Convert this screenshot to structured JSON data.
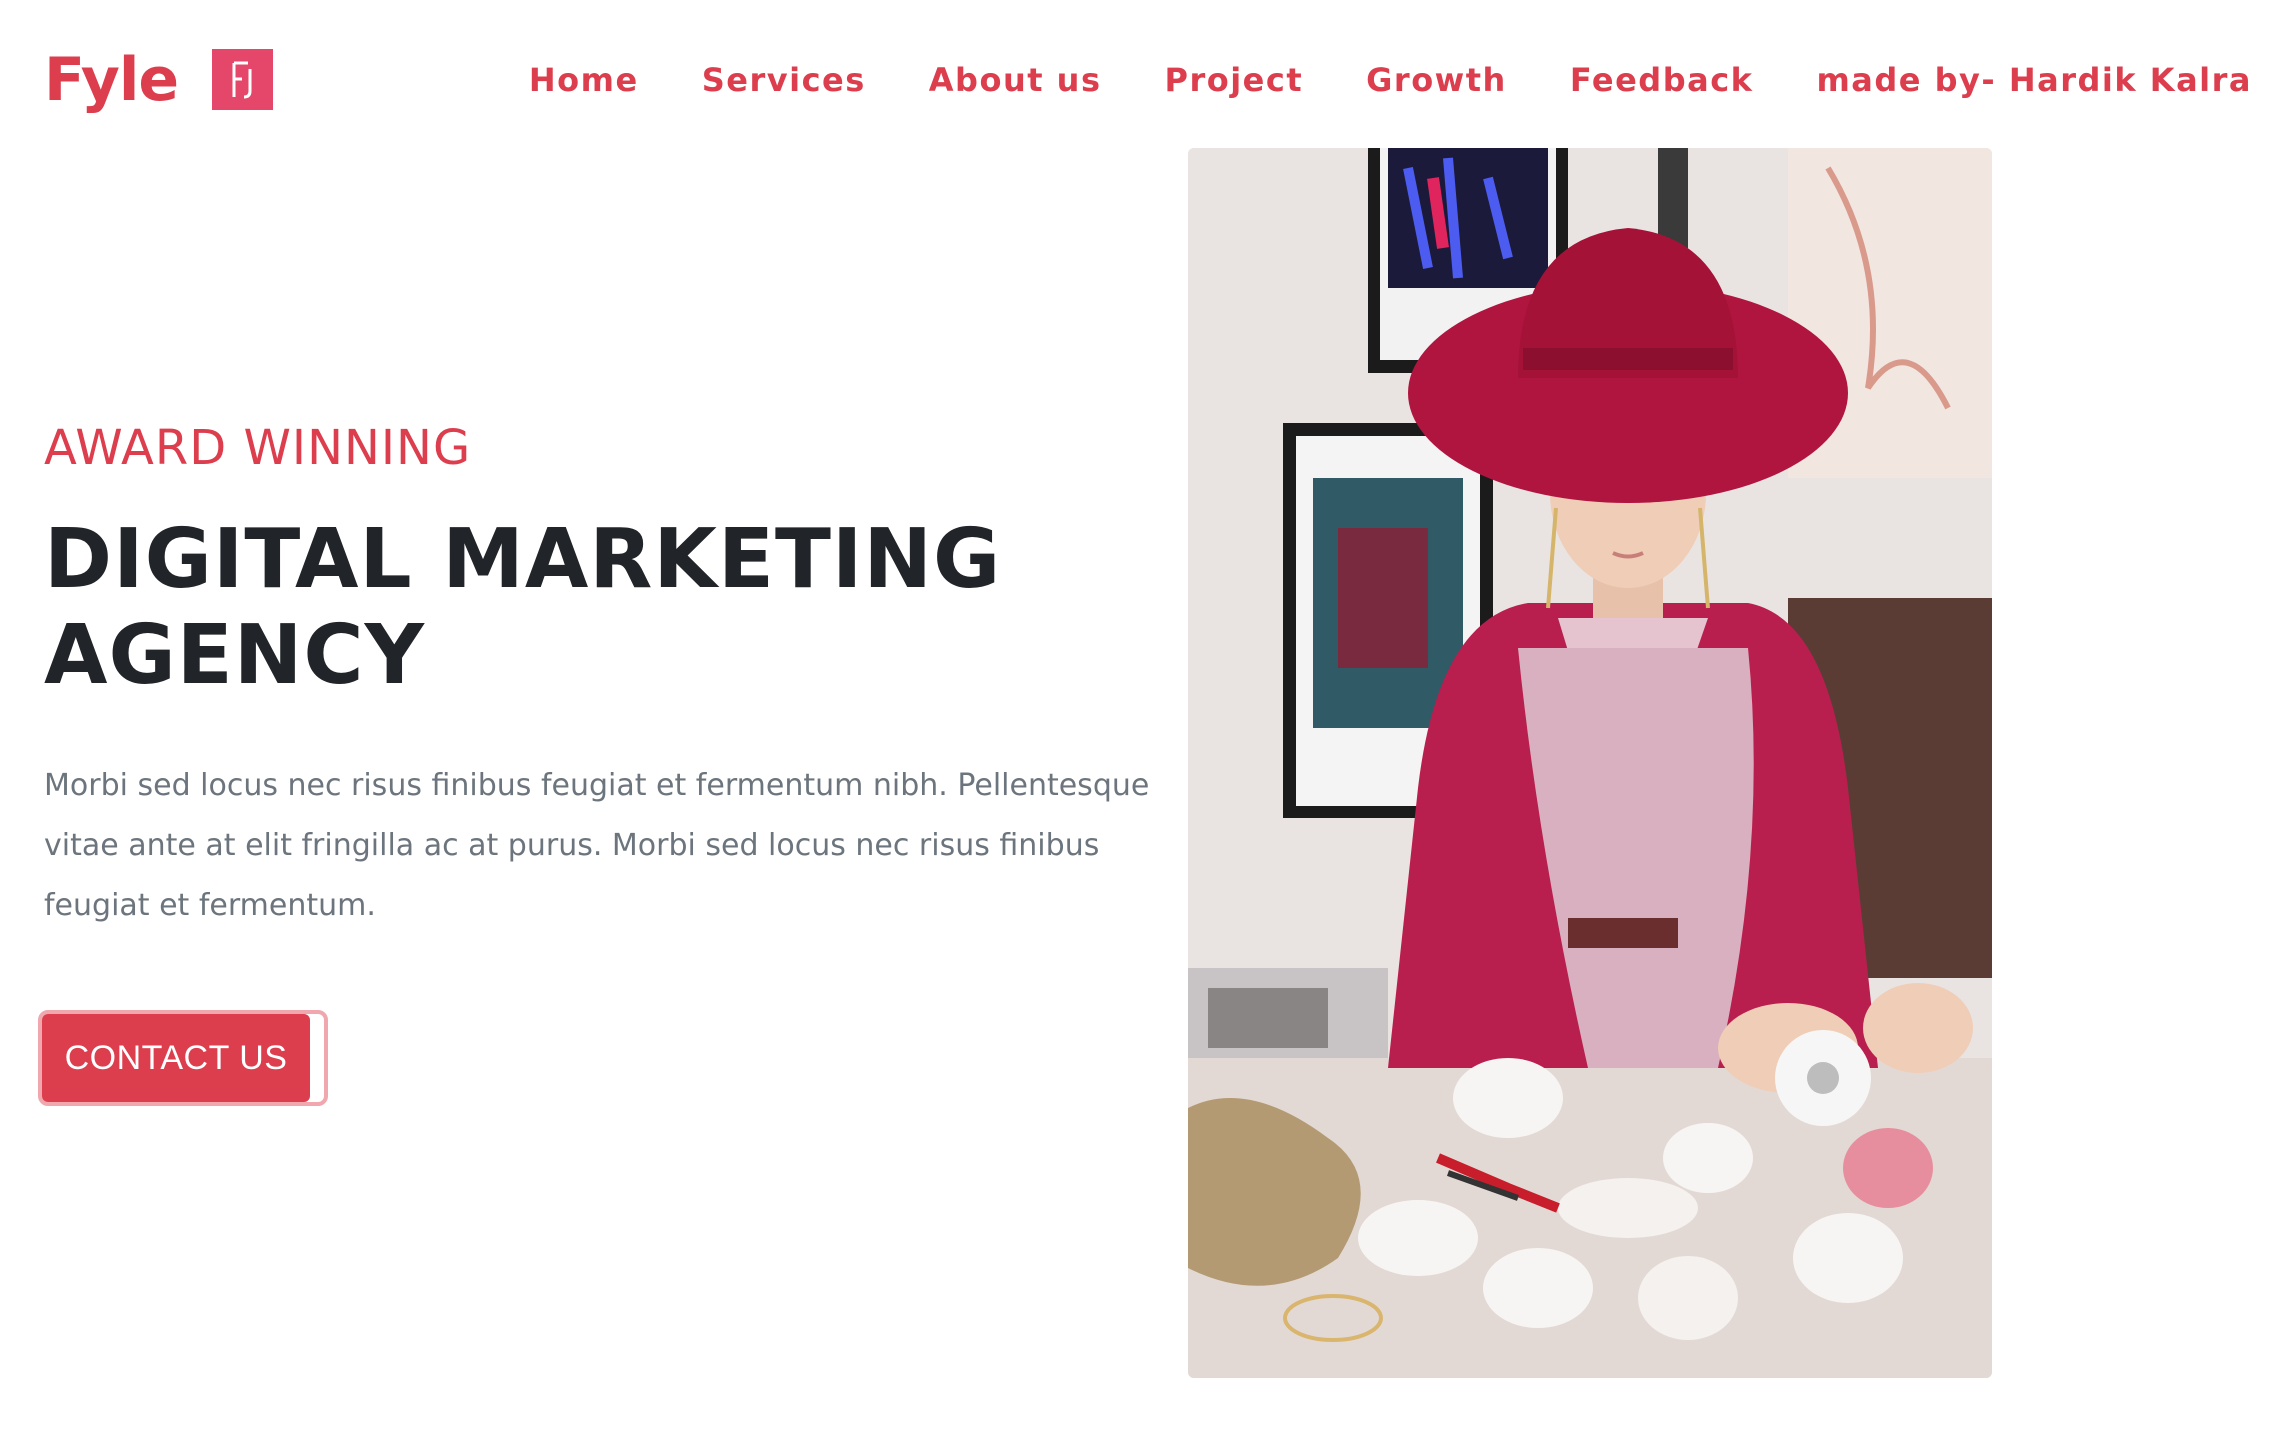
{
  "brand": {
    "name": "Fyle",
    "logo_icon": "fyle-logo-icon",
    "accent_color": "#dc3e4e"
  },
  "nav": {
    "items": [
      {
        "label": "Home"
      },
      {
        "label": "Services"
      },
      {
        "label": "About us"
      },
      {
        "label": "Project"
      },
      {
        "label": "Growth"
      },
      {
        "label": "Feedback"
      },
      {
        "label": "made by- Hardik Kalra"
      }
    ]
  },
  "hero": {
    "eyebrow": "AWARD WINNING",
    "headline_line1": "DIGITAL MARKETING",
    "headline_line2": "AGENCY",
    "body_line1": "Morbi sed locus nec risus finibus feugiat et fermentum nibh. Pellentesque",
    "body_line2": "vitae ante at elit fringilla ac at purus. Morbi sed locus nec risus finibus",
    "body_line3": "feugiat et fermentum.",
    "cta_label": "CONTACT US",
    "photo_icon": "hero-photo-woman-in-red-hat"
  },
  "colors": {
    "accent": "#dc3e4e",
    "heading": "#212529",
    "body": "#6c757d",
    "logo_mark": "#e5476a"
  }
}
